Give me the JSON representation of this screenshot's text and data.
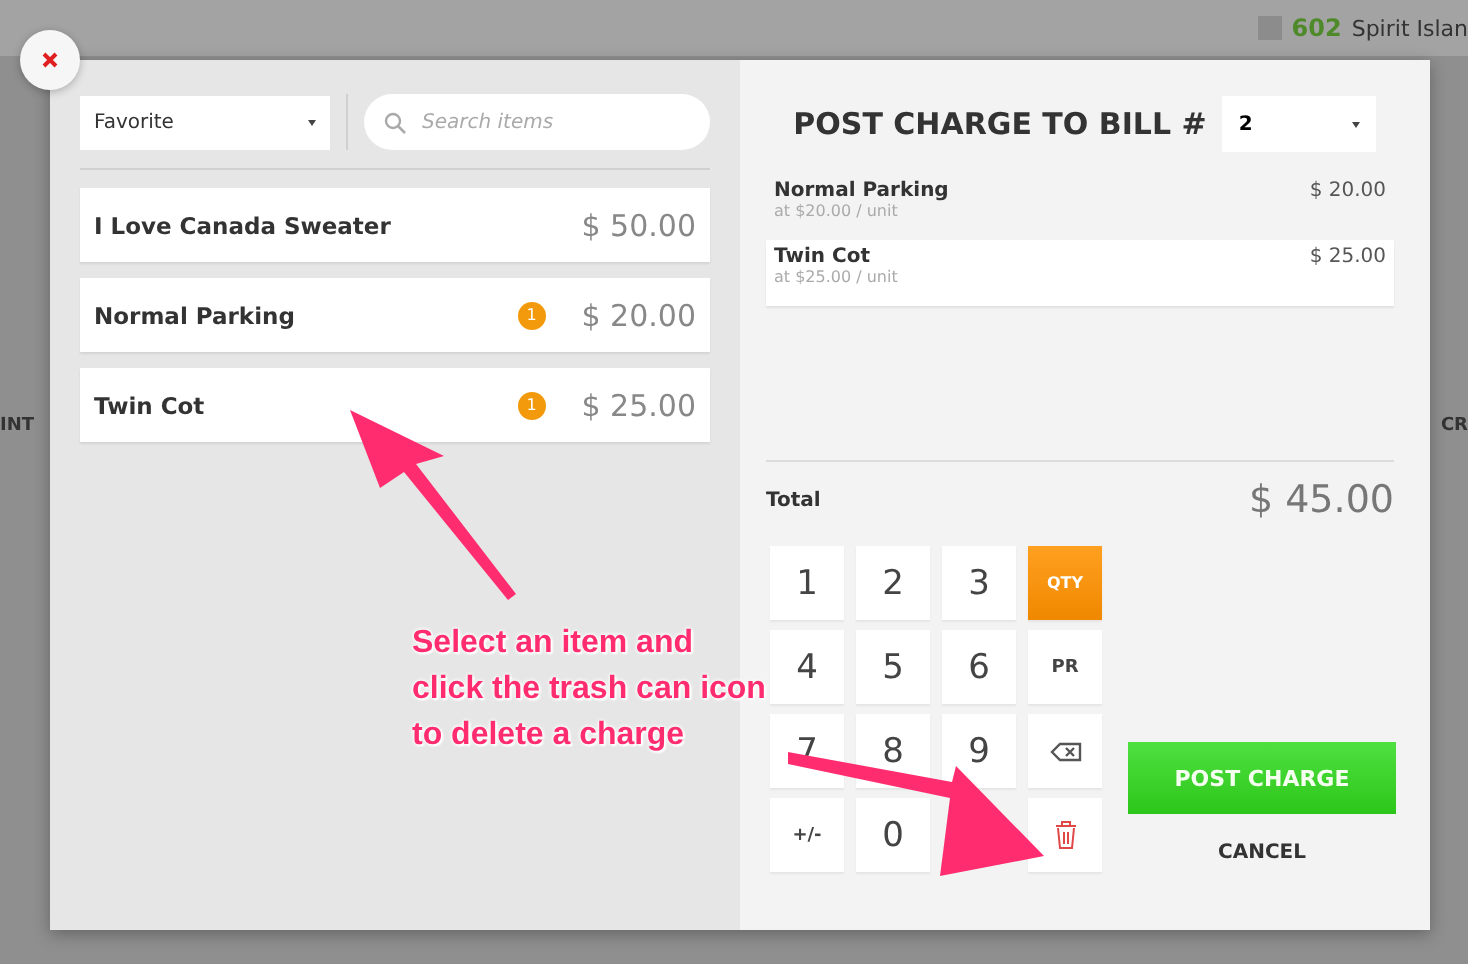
{
  "background": {
    "room_number": "602",
    "room_name": "Spirit Islan",
    "left_label": "INT",
    "right_label": "CR"
  },
  "catalog": {
    "category": "Favorite",
    "search": {
      "placeholder": "Search items"
    },
    "items": [
      {
        "name": "I Love Canada Sweater",
        "price": "$ 50.00"
      },
      {
        "name": "Normal Parking",
        "price": "$ 20.00",
        "count": "1"
      },
      {
        "name": "Twin Cot",
        "price": "$ 25.00",
        "count": "1"
      }
    ]
  },
  "bill": {
    "title": "POST CHARGE TO BILL #",
    "bill_number": "2",
    "lines": [
      {
        "name": "Normal Parking",
        "unit": "at $20.00 / unit",
        "amount": "$ 20.00",
        "selected": false
      },
      {
        "name": "Twin Cot",
        "unit": "at $25.00 / unit",
        "amount": "$ 25.00",
        "selected": true
      }
    ],
    "total_label": "Total",
    "total": "$ 45.00"
  },
  "keypad": [
    {
      "kind": "digit",
      "label": "1"
    },
    {
      "kind": "digit",
      "label": "2"
    },
    {
      "kind": "digit",
      "label": "3"
    },
    {
      "kind": "qty",
      "label": "QTY"
    },
    {
      "kind": "digit",
      "label": "4"
    },
    {
      "kind": "digit",
      "label": "5"
    },
    {
      "kind": "digit",
      "label": "6"
    },
    {
      "kind": "text",
      "label": "PR"
    },
    {
      "kind": "digit",
      "label": "7"
    },
    {
      "kind": "digit",
      "label": "8"
    },
    {
      "kind": "digit",
      "label": "9"
    },
    {
      "kind": "backspace"
    },
    {
      "kind": "text",
      "label": "+/-"
    },
    {
      "kind": "digit",
      "label": "0"
    },
    {
      "kind": "trash"
    }
  ],
  "actions": {
    "post": "POST CHARGE",
    "cancel": "CANCEL"
  },
  "annotation": {
    "lines": [
      "Select an item and",
      "click the trash can icon",
      "to delete a charge"
    ]
  }
}
